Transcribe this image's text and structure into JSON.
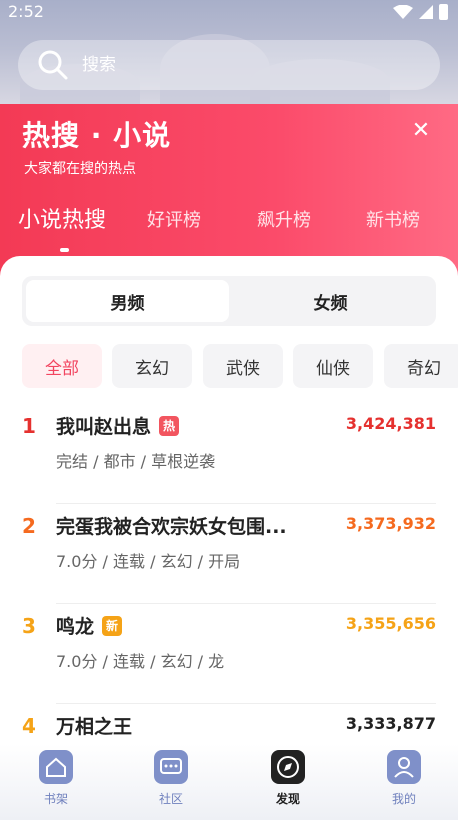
{
  "status": {
    "time": "2:52"
  },
  "search": {
    "placeholder": "搜索"
  },
  "hero": {
    "title": "热搜 · 小说",
    "subtitle": "大家都在搜的热点",
    "close": "✕",
    "tabs": [
      "小说热搜",
      "好评榜",
      "飙升榜",
      "新书榜"
    ]
  },
  "segment": [
    "男频",
    "女频"
  ],
  "categories": [
    "全部",
    "玄幻",
    "武侠",
    "仙侠",
    "奇幻"
  ],
  "books": [
    {
      "rank": "1",
      "title": "我叫赵出息",
      "badge": "热",
      "meta": "完结 / 都市 / 草根逆袭",
      "count": "3,424,381"
    },
    {
      "rank": "2",
      "title": "完蛋我被合欢宗妖女包围...",
      "badge": "",
      "meta": "7.0分 / 连载 / 玄幻 / 开局",
      "count": "3,373,932"
    },
    {
      "rank": "3",
      "title": "鸣龙",
      "badge": "新",
      "meta": "7.0分 / 连载 / 玄幻 / 龙",
      "count": "3,355,656"
    },
    {
      "rank": "4",
      "title": "万相之王",
      "badge": "",
      "meta": "",
      "count": "3,333,877"
    }
  ],
  "nav": [
    "书架",
    "社区",
    "发现",
    "我的"
  ],
  "colors": {
    "accent": "#f24560",
    "rank1": "#e5312f",
    "rank2": "#f56a1f",
    "rank3": "#f5a317",
    "hot": "#f2555f",
    "new": "#f5a317"
  }
}
